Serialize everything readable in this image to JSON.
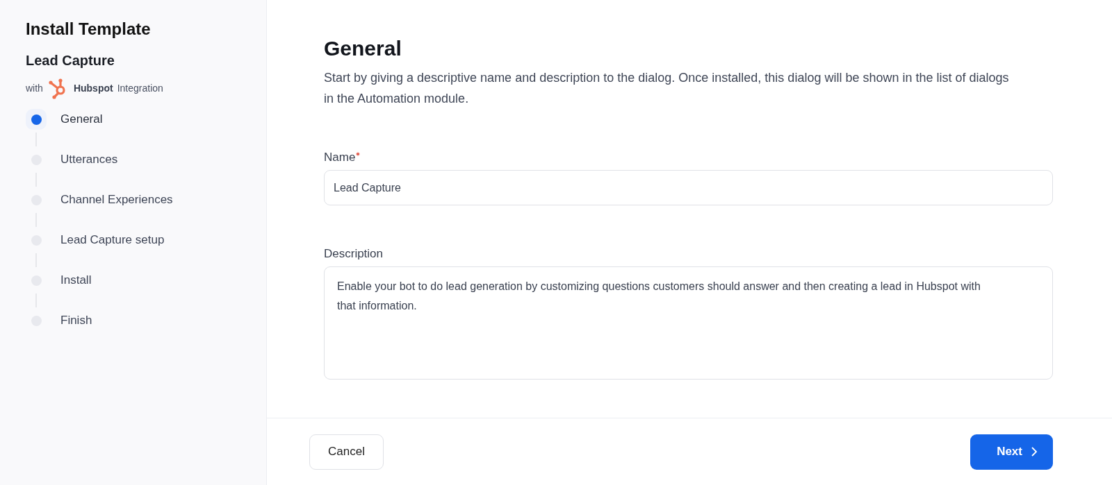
{
  "sidebar": {
    "title": "Install Template",
    "subtitle": "Lead Capture",
    "integration": {
      "prefix": "with",
      "brand": "Hubspot",
      "suffix": "Integration"
    },
    "steps": [
      {
        "label": "General",
        "selected": true
      },
      {
        "label": "Utterances",
        "selected": false
      },
      {
        "label": "Channel Experiences",
        "selected": false
      },
      {
        "label": "Lead Capture setup",
        "selected": false
      },
      {
        "label": "Install",
        "selected": false
      },
      {
        "label": "Finish",
        "selected": false
      }
    ]
  },
  "main": {
    "heading": "General",
    "intro": "Start by giving a descriptive name and description to the dialog. Once installed, this dialog will be shown in the list of dialogs in the Automation module.",
    "fields": [
      {
        "kind": "input",
        "label": "Name",
        "required": true,
        "value": "Lead Capture"
      },
      {
        "kind": "textarea",
        "label": "Description",
        "required": false,
        "value": "Enable your bot to do lead generation by customizing questions customers should answer and then creating a lead in Hubspot with that information."
      }
    ]
  },
  "footer": {
    "cancel": "Cancel",
    "next": "Next"
  }
}
